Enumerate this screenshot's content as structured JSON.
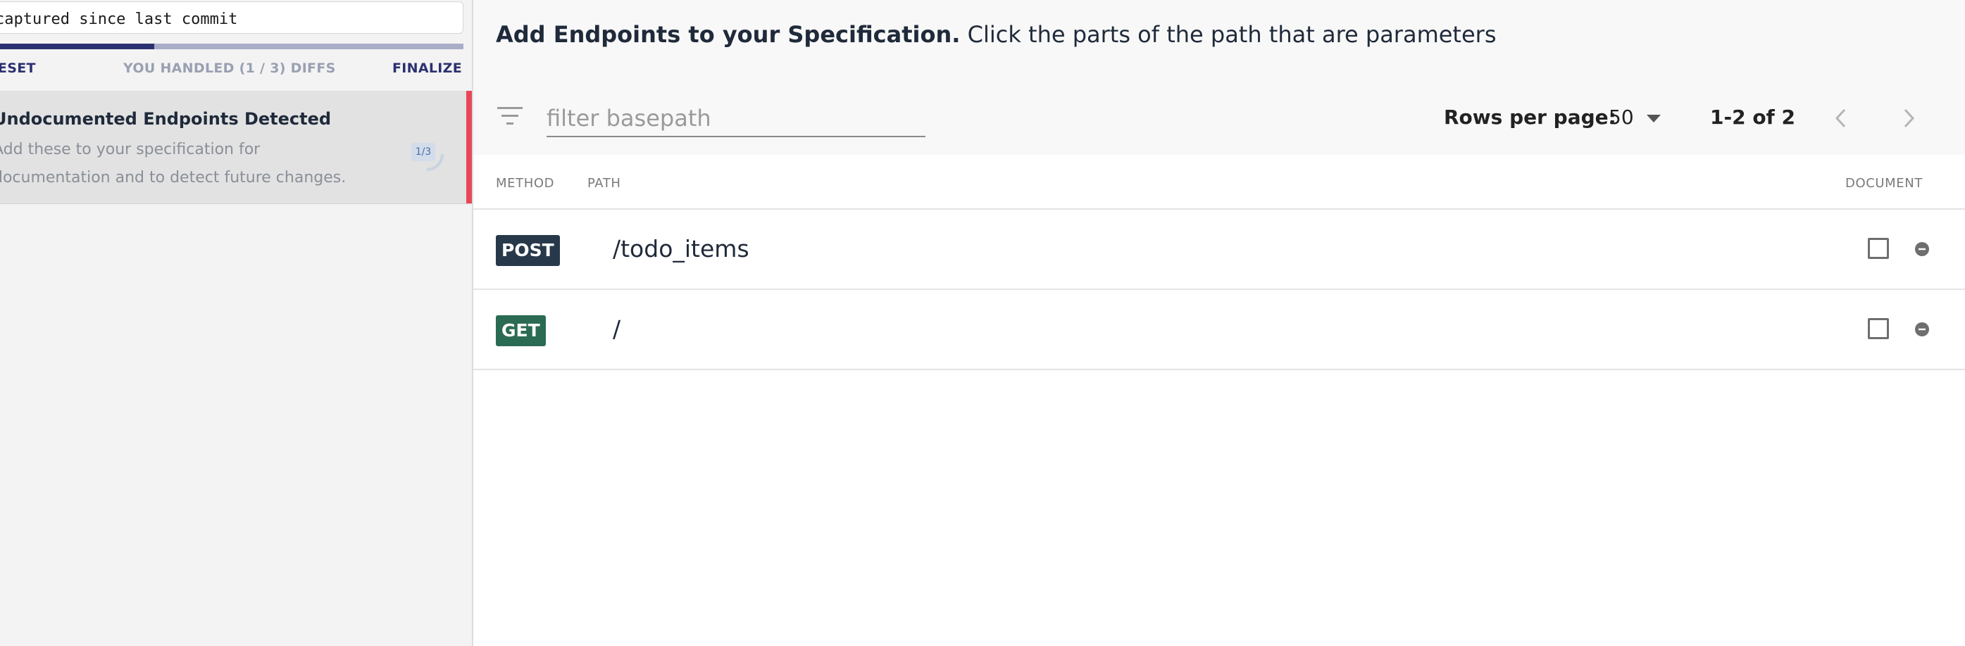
{
  "sidebar": {
    "capture_label": "captured since last commit",
    "progress": {
      "handled": 1,
      "total": 3,
      "color_fill": "#2b3170",
      "color_track": "#a9adc8"
    },
    "reset_label": "RESET",
    "status_label": "YOU HANDLED (1 / 3) DIFFS",
    "finalize_label": "FINALIZE",
    "diff_card": {
      "title": "Undocumented Endpoints Detected",
      "description": "Add these to your specification for documentation and to detect future changes.",
      "counter": "1/3",
      "accent_color": "#e8475a"
    }
  },
  "main": {
    "title_bold": "Add Endpoints to your Specification.",
    "title_rest": "Click the parts of the path that are parameters",
    "filter": {
      "placeholder": "filter basepath",
      "value": ""
    },
    "pagination": {
      "rows_per_page_label": "Rows per page:",
      "rows_per_page_value": "50",
      "range": "1-2 of 2"
    },
    "table": {
      "columns": {
        "method": "METHOD",
        "path": "PATH",
        "document": "DOCUMENT"
      },
      "rows": [
        {
          "method": "POST",
          "path": "/todo_items",
          "method_color": "#27384a",
          "checked": false
        },
        {
          "method": "GET",
          "path": "/",
          "method_color": "#2b6b53",
          "checked": false
        }
      ]
    }
  },
  "icons": [
    "filter-icon",
    "chevron-down-icon",
    "chevron-left-icon",
    "chevron-right-icon",
    "remove-circle-icon",
    "progress-ring-icon"
  ]
}
